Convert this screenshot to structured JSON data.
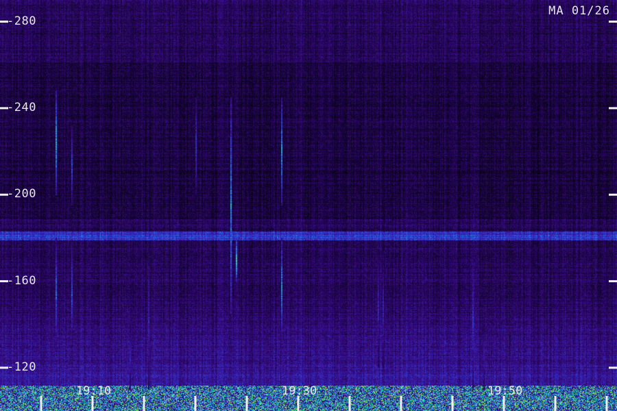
{
  "stamp": "MA 01/26",
  "chart_data": {
    "type": "heatmap",
    "title": "",
    "xlabel": "",
    "ylabel": "",
    "y_ticks": [
      "120",
      "160",
      "200",
      "240",
      "280"
    ],
    "y_tick_values": [
      120,
      160,
      200,
      240,
      280
    ],
    "x_ticks": [
      "19:10",
      "19:30",
      "19:50"
    ],
    "x_tick_minutes_after_1900": [
      10,
      30,
      50
    ],
    "ylim": [
      100,
      290
    ],
    "xlim_minutes_after_1900": [
      1,
      61
    ],
    "colormap": [
      "#000000",
      "#1a0440",
      "#3a0c8a",
      "#2f3cd8",
      "#1ea0d8",
      "#2ee0a8",
      "#c8f030"
    ],
    "background_level": 0.22,
    "bright_band": {
      "y_range": [
        104,
        112
      ],
      "level": 0.85
    },
    "interference_band": {
      "y_range": [
        179,
        183
      ],
      "level": 0.5
    },
    "events_minutes_after_1900": [
      {
        "t": 6.4,
        "y_range": [
          200,
          248
        ],
        "peak": 0.75
      },
      {
        "t": 6.4,
        "y_range": [
          130,
          180
        ],
        "peak": 0.6
      },
      {
        "t": 7.9,
        "y_range": [
          195,
          232
        ],
        "peak": 0.55
      },
      {
        "t": 7.9,
        "y_range": [
          130,
          178
        ],
        "peak": 0.55
      },
      {
        "t": 20.0,
        "y_range": [
          200,
          245
        ],
        "peak": 0.5
      },
      {
        "t": 23.4,
        "y_range": [
          145,
          245
        ],
        "peak": 0.7
      },
      {
        "t": 23.9,
        "y_range": [
          160,
          180
        ],
        "peak": 0.85
      },
      {
        "t": 28.3,
        "y_range": [
          195,
          245
        ],
        "peak": 0.7
      },
      {
        "t": 28.3,
        "y_range": [
          135,
          180
        ],
        "peak": 0.7
      },
      {
        "t": 15.4,
        "y_range": [
          110,
          175
        ],
        "peak": 0.45
      },
      {
        "t": 13.6,
        "y_range": [
          110,
          140
        ],
        "peak": 0.45
      },
      {
        "t": 37.7,
        "y_range": [
          120,
          175
        ],
        "peak": 0.45
      },
      {
        "t": 38.2,
        "y_range": [
          120,
          173
        ],
        "peak": 0.45
      },
      {
        "t": 46.9,
        "y_range": [
          110,
          175
        ],
        "peak": 0.5
      },
      {
        "t": 48.0,
        "y_range": [
          110,
          140
        ],
        "peak": 0.4
      },
      {
        "t": 50.5,
        "y_range": [
          110,
          135
        ],
        "peak": 0.35
      }
    ]
  }
}
